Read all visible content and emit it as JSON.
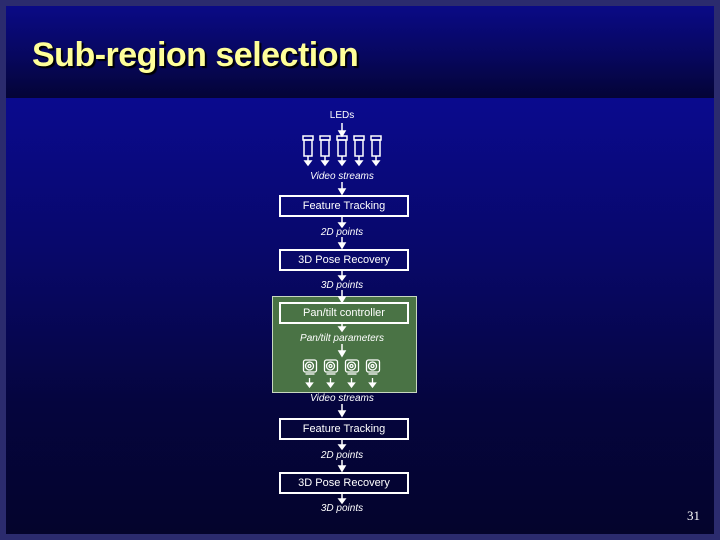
{
  "slide": {
    "title": "Sub-region selection",
    "page_number": "31"
  },
  "diagram": {
    "top_input_label": "LEDs",
    "led_camera_count": 5,
    "stage1": {
      "streams_label": "Video streams",
      "feature_tracking": "Feature Tracking",
      "points_2d": "2D points",
      "pose_recovery": "3D Pose Recovery",
      "points_3d": "3D points"
    },
    "controller_panel": {
      "controller": "Pan/tilt controller",
      "parameters_label": "Pan/tilt parameters",
      "ptz_camera_count": 4
    },
    "stage2": {
      "streams_label": "Video streams",
      "feature_tracking": "Feature Tracking",
      "points_2d": "2D points",
      "pose_recovery": "3D Pose Recovery",
      "points_3d": "3D points"
    },
    "colors": {
      "title": "#ffff99",
      "panel_green": "#4a7345",
      "lines": "#ffffff"
    }
  }
}
